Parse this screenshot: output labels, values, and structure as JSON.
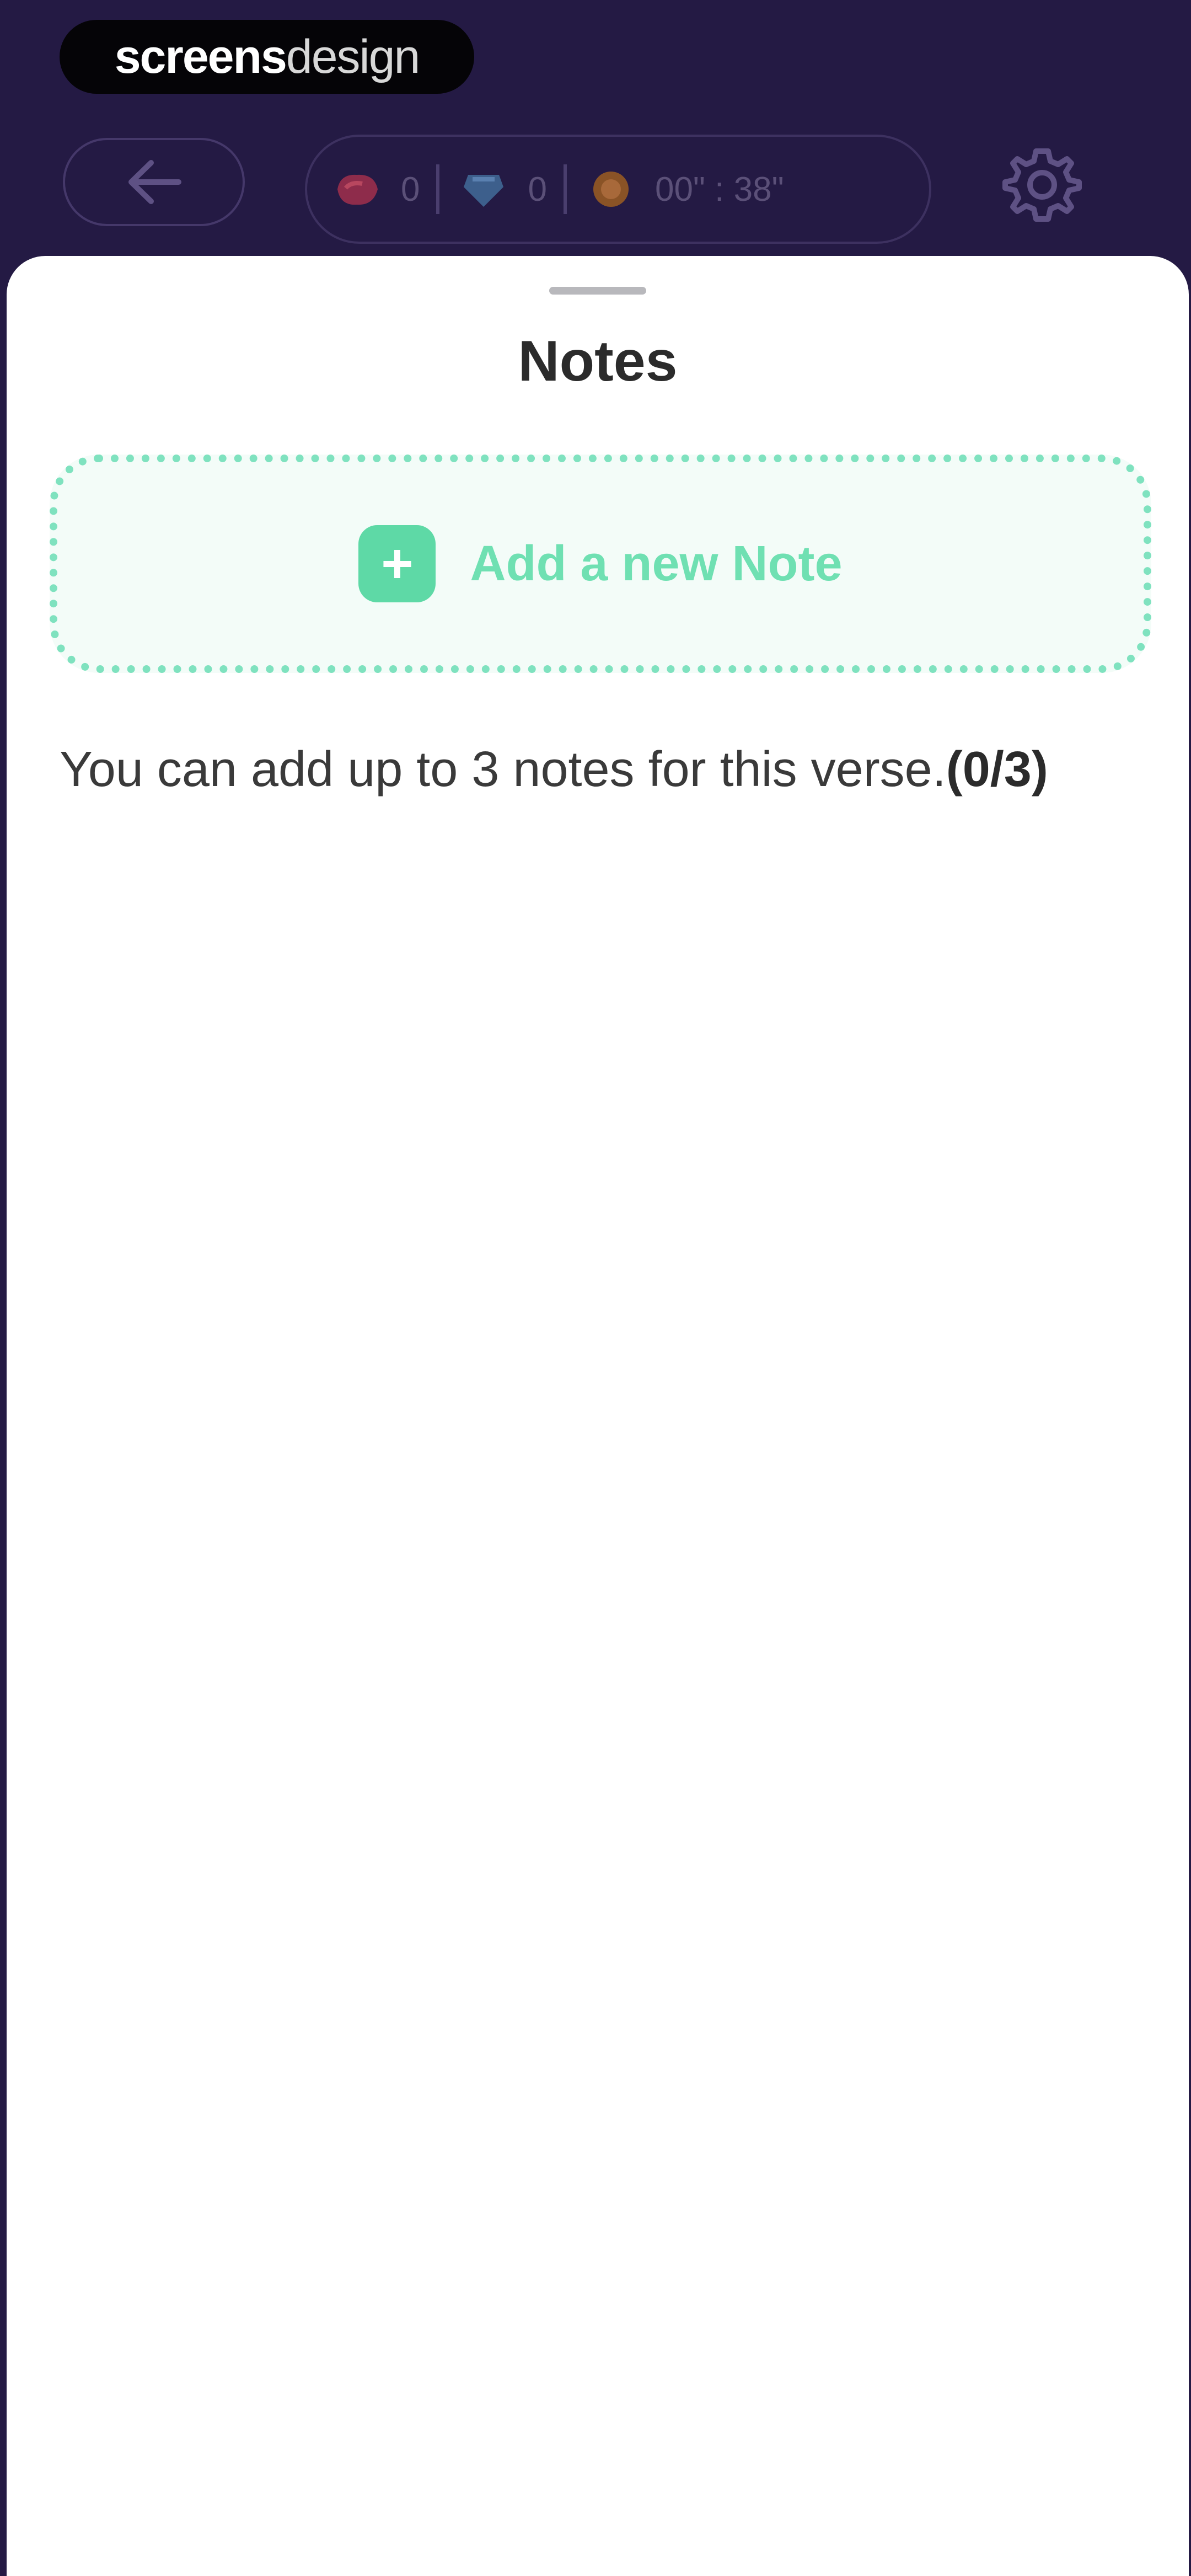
{
  "watermark": {
    "brand_bold": "screens",
    "brand_light": "design"
  },
  "header": {
    "back_icon": "arrow-left-icon",
    "stats": [
      {
        "icon": "red-gem-icon",
        "color": "#c0395a",
        "value": "0"
      },
      {
        "icon": "blue-gem-icon",
        "color": "#4a7fbf",
        "value": "0"
      },
      {
        "icon": "amber-gem-icon",
        "color": "#c07a34",
        "value": "00\" : 38\""
      }
    ],
    "settings_icon": "gear-icon"
  },
  "sheet": {
    "title": "Notes",
    "add_note_label": "Add a new Note",
    "add_icon": "plus-icon",
    "info_text": "You can add up to 3 notes for this verse.",
    "info_count": "(0/3)"
  },
  "colors": {
    "header_bg": "#241a44",
    "accent_green": "#5ed9a6",
    "sheet_bg": "#ffffff"
  }
}
